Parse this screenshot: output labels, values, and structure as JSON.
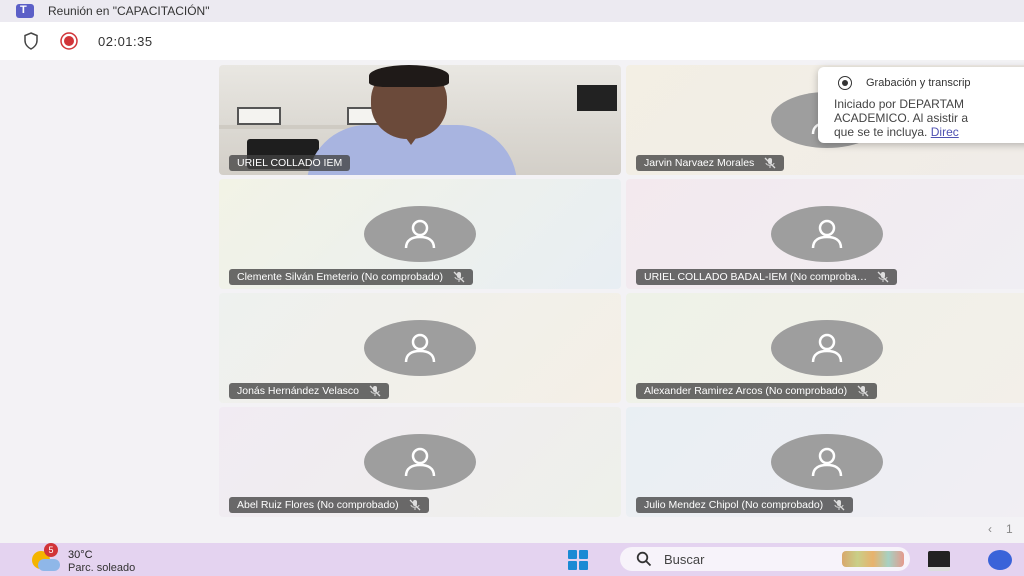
{
  "window": {
    "title": "Reunión en \"CAPACITACIÓN\""
  },
  "toolbar": {
    "timer": "02:01:35",
    "shield_icon": "shield-icon",
    "recording_icon": "record-icon"
  },
  "participants": [
    {
      "name": "URIEL COLLADO IEM",
      "video": true,
      "muted": false
    },
    {
      "name": "Jarvin Narvaez Morales",
      "video": false,
      "muted": true
    },
    {
      "name": "Clemente Silván Emeterio (No comprobado)",
      "video": false,
      "muted": true
    },
    {
      "name": "URIEL COLLADO BADAL-IEM (No comproba…",
      "video": false,
      "muted": true
    },
    {
      "name": "Jonás Hernández Velasco",
      "video": false,
      "muted": true
    },
    {
      "name": "Alexander Ramirez Arcos (No comprobado)",
      "video": false,
      "muted": true
    },
    {
      "name": "Abel Ruiz Flores (No comprobado)",
      "video": false,
      "muted": true
    },
    {
      "name": "Julio Mendez Chipol (No comprobado)",
      "video": false,
      "muted": true
    }
  ],
  "notification": {
    "title": "Grabación y transcrip",
    "line1": "Iniciado por DEPARTAM",
    "line2": "ACADEMICO. Al asistir a",
    "line3_text": "que se te incluya. ",
    "line3_link": "Direc"
  },
  "pager": {
    "prev": "‹",
    "page": "1"
  },
  "taskbar": {
    "weather_badge": "5",
    "temperature": "30°C",
    "weather_desc": "Parc. soleado",
    "search_label": "Buscar"
  },
  "colors": {
    "accent": "#5b5fc7",
    "record": "#d13438",
    "taskbar": "#e4d3f0"
  }
}
